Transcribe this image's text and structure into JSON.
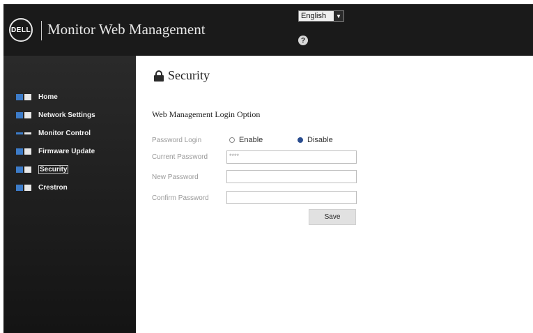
{
  "header": {
    "logo_text": "DELL",
    "app_title": "Monitor Web Management",
    "language": "English",
    "help_icon": "help-circle-icon"
  },
  "sidebar": {
    "items": [
      {
        "label": "Home",
        "icon": "home-icon"
      },
      {
        "label": "Network Settings",
        "icon": "network-icon"
      },
      {
        "label": "Monitor Control",
        "icon": "monitor-control-icon"
      },
      {
        "label": "Firmware Update",
        "icon": "firmware-update-icon"
      },
      {
        "label": "Security",
        "icon": "security-icon",
        "active": true
      },
      {
        "label": "Crestron",
        "icon": "crestron-icon"
      }
    ]
  },
  "main": {
    "section_title": "Security",
    "section_icon": "lock-icon",
    "subheading": "Web Management Login Option",
    "password_login_label": "Password Login",
    "enable_label": "Enable",
    "disable_label": "Disable",
    "selected_option": "Disable",
    "current_password_label": "Current Password",
    "current_password_value": "****",
    "new_password_label": "New Password",
    "new_password_value": "",
    "confirm_password_label": "Confirm Password",
    "confirm_password_value": "",
    "save_label": "Save"
  },
  "colors": {
    "header_bg": "#1a1a1a",
    "sidebar_bg": "#1e1e1e",
    "accent_blue": "#3d7cc9",
    "radio_selected": "#2a4d8f"
  }
}
